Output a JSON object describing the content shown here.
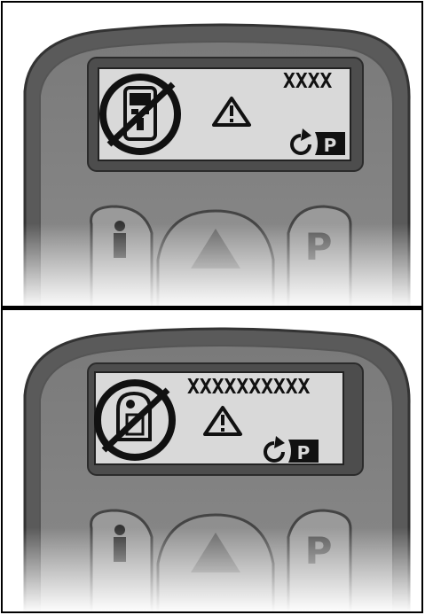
{
  "panels": [
    {
      "id": "top",
      "lcd_text": "XXXX",
      "crossed_icon": "handheld-remote-crossed-icon",
      "warning_icon": "warning-triangle-icon",
      "status_icons": [
        "rotate-arrow-icon",
        "parking-p-icon"
      ],
      "button_icons": [
        "person-icon",
        "up-arrow-icon",
        "parking-p-icon"
      ]
    },
    {
      "id": "bottom",
      "lcd_text": "XXXXXXXXXX",
      "crossed_icon": "user-device-crossed-icon",
      "warning_icon": "warning-triangle-icon",
      "status_icons": [
        "rotate-arrow-icon",
        "parking-p-icon"
      ],
      "button_icons": [
        "person-icon",
        "up-arrow-icon",
        "parking-p-icon"
      ]
    }
  ],
  "colors": {
    "device_body": "#6e6e6e",
    "device_bezel": "#4a4a4a",
    "lcd_background": "#d9d9d9",
    "lcd_ink": "#111111",
    "button_face": "#9c9c9c"
  }
}
